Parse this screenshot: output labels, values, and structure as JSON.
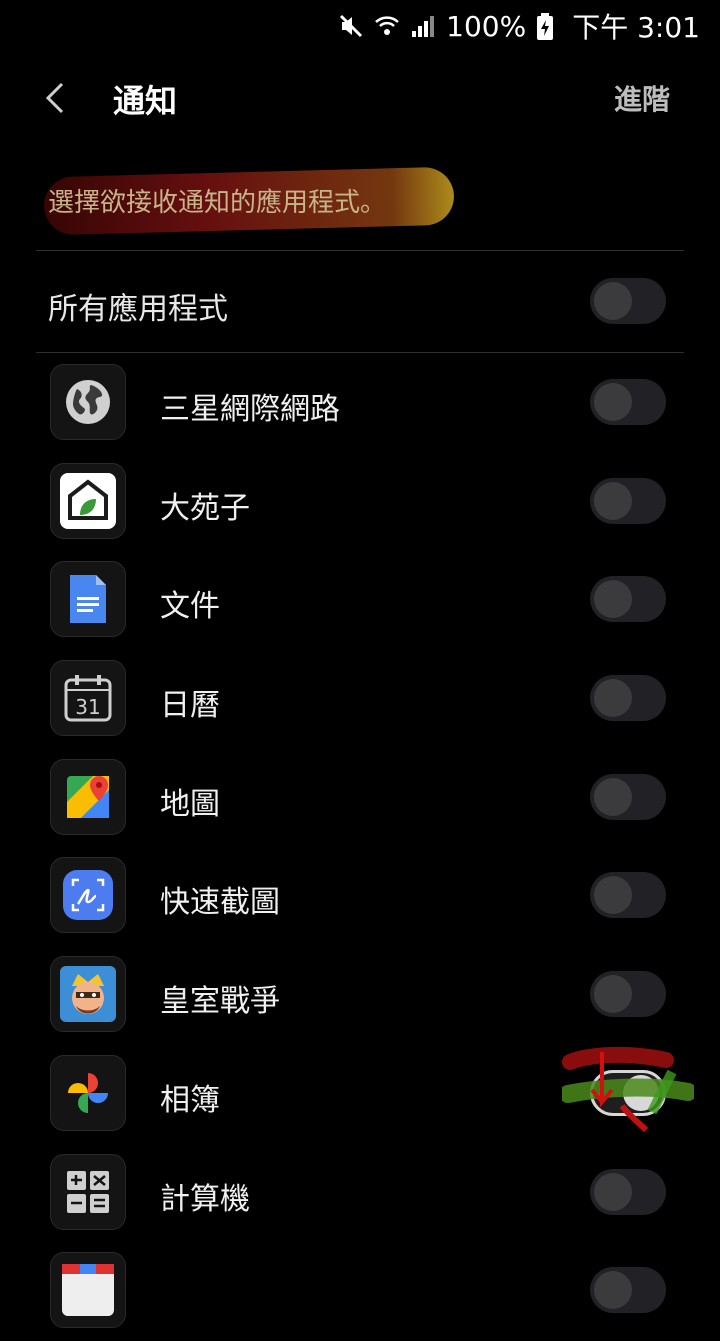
{
  "status": {
    "battery": "100%",
    "time": "下午 3:01"
  },
  "header": {
    "title": "通知",
    "advanced": "進階"
  },
  "description": "選擇欲接收通知的應用程式。",
  "all_apps": {
    "label": "所有應用程式",
    "enabled": false
  },
  "apps": [
    {
      "name": "三星網際網路",
      "icon": "globe-icon",
      "enabled": false
    },
    {
      "name": "大苑子",
      "icon": "house-icon",
      "enabled": false
    },
    {
      "name": "文件",
      "icon": "docs-icon",
      "enabled": false
    },
    {
      "name": "日曆",
      "icon": "calendar-icon",
      "enabled": false
    },
    {
      "name": "地圖",
      "icon": "maps-icon",
      "enabled": false
    },
    {
      "name": "快速截圖",
      "icon": "screenshot-icon",
      "enabled": false
    },
    {
      "name": "皇室戰爭",
      "icon": "game-icon",
      "enabled": false
    },
    {
      "name": "相簿",
      "icon": "photos-icon",
      "enabled": true
    },
    {
      "name": "計算機",
      "icon": "calculator-icon",
      "enabled": false
    },
    {
      "name": "",
      "icon": "app-icon",
      "enabled": false
    }
  ],
  "calendar_day": "31",
  "colors": {
    "accent": "#d8d8d8",
    "background": "#000000",
    "highlight": "#6b1010"
  }
}
